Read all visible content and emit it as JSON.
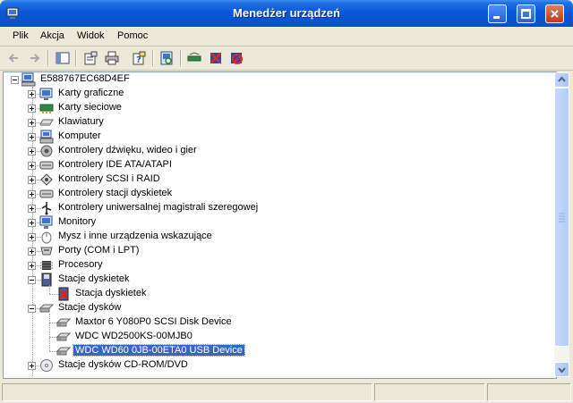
{
  "window": {
    "title": "Menedżer urządzeń"
  },
  "menu": [
    {
      "label": "Plik"
    },
    {
      "label": "Akcja"
    },
    {
      "label": "Widok"
    },
    {
      "label": "Pomoc"
    }
  ],
  "toolbar": {
    "buttons": [
      "back-icon",
      "forward-icon",
      "show-hide-tree-icon",
      "properties-icon",
      "print-icon",
      "help-icon",
      "scan-hardware-icon",
      "update-driver-icon",
      "uninstall-icon",
      "disable-icon"
    ]
  },
  "tree": {
    "root": "E588767EC68D4EF",
    "items": [
      {
        "label": "Karty graficzne",
        "icon": "display-adapter-icon"
      },
      {
        "label": "Karty sieciowe",
        "icon": "network-adapter-icon"
      },
      {
        "label": "Klawiatury",
        "icon": "keyboard-icon"
      },
      {
        "label": "Komputer",
        "icon": "computer-icon"
      },
      {
        "label": "Kontrolery dźwięku, wideo i gier",
        "icon": "sound-icon"
      },
      {
        "label": "Kontrolery IDE ATA/ATAPI",
        "icon": "ide-controller-icon"
      },
      {
        "label": "Kontrolery SCSI i RAID",
        "icon": "scsi-icon"
      },
      {
        "label": "Kontrolery stacji dyskietek",
        "icon": "floppy-controller-icon"
      },
      {
        "label": "Kontrolery uniwersalnej magistrali szeregowej",
        "icon": "usb-icon"
      },
      {
        "label": "Monitory",
        "icon": "monitor-icon"
      },
      {
        "label": "Mysz i inne urządzenia wskazujące",
        "icon": "mouse-icon"
      },
      {
        "label": "Porty (COM i LPT)",
        "icon": "port-icon"
      },
      {
        "label": "Procesory",
        "icon": "processor-icon"
      },
      {
        "label": "Stacje dyskietek",
        "icon": "floppy-drive-icon"
      },
      {
        "label": "Stacja dyskietek",
        "icon": "floppy-error-icon",
        "child": true
      },
      {
        "label": "Stacje dysków",
        "icon": "disk-drive-icon"
      },
      {
        "label": "Maxtor 6 Y080P0 SCSI Disk Device",
        "icon": "disk-icon",
        "child": true
      },
      {
        "label": "WDC WD2500KS-00MJB0",
        "icon": "disk-icon",
        "child": true
      },
      {
        "label": "WDC WD60 0JB-00ETA0 USB Device",
        "icon": "disk-icon",
        "child": true,
        "selected": true
      },
      {
        "label": "Stacje dysków CD-ROM/DVD",
        "icon": "cdrom-icon"
      }
    ]
  }
}
